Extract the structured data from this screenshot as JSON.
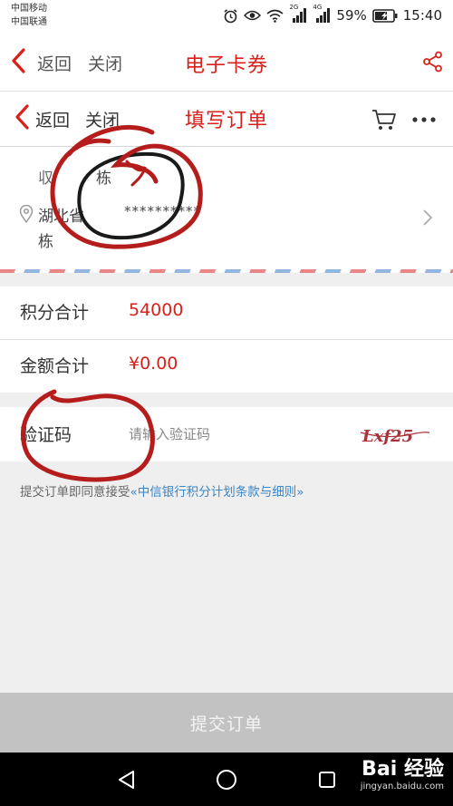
{
  "status_bar": {
    "carrier_1": "中国移动",
    "carrier_2": "中国联通",
    "network_1": "2G",
    "network_2": "4G",
    "battery": "59%",
    "time": "15:40"
  },
  "outer_nav": {
    "back_label": "返回",
    "close_label": "关闭",
    "title": "电子卡券"
  },
  "inner_nav": {
    "back_label": "返回",
    "close_label": "关闭",
    "title": "填写订单"
  },
  "address": {
    "recipient_name": "栋",
    "address_line": "湖北省",
    "masked_detail": "**********",
    "address_line_2": "栋"
  },
  "summary": {
    "points_label": "积分合计",
    "points_value": "54000",
    "amount_label": "金额合计",
    "amount_value": "¥0.00"
  },
  "captcha": {
    "label": "验证码",
    "placeholder": "请输入验证码",
    "image_text": "Lxf25"
  },
  "terms": {
    "prefix": "提交订单即同意接受",
    "link": "«中信银行积分计划条款与细则»"
  },
  "submit": {
    "label": "提交订单"
  },
  "watermark": {
    "brand": "Bai 经验",
    "url": "jingyan.baidu.com"
  },
  "colors": {
    "brand_red": "#d9211b",
    "link_blue": "#3a86c8",
    "submit_disabled": "#c2c2c2"
  }
}
